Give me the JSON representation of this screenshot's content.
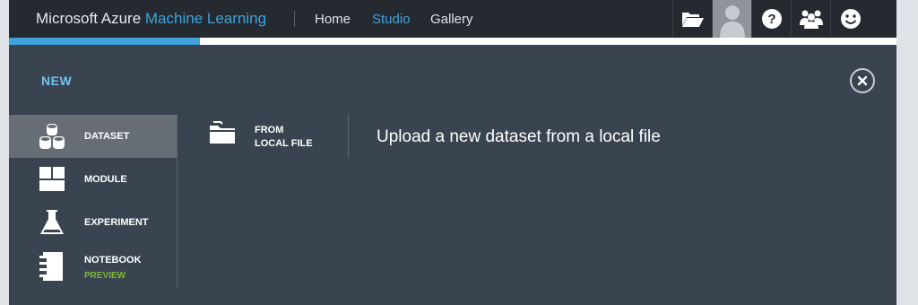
{
  "header": {
    "brand_prefix": "Microsoft Azure",
    "brand_accent": "Machine Learning",
    "nav": [
      {
        "label": "Home",
        "active": false
      },
      {
        "label": "Studio",
        "active": true
      },
      {
        "label": "Gallery",
        "active": false
      }
    ],
    "icons": [
      "folder-open-icon",
      "user-avatar-icon",
      "help-icon",
      "community-icon",
      "feedback-smiley-icon"
    ]
  },
  "progress": {
    "fraction": 0.215
  },
  "panel": {
    "title": "NEW",
    "close_icon": "close-icon"
  },
  "sidebar": {
    "items": [
      {
        "label": "DATASET",
        "icon": "dataset-cylinders-icon",
        "active": true
      },
      {
        "label": "MODULE",
        "icon": "module-blocks-icon",
        "active": false
      },
      {
        "label": "EXPERIMENT",
        "icon": "experiment-flask-icon",
        "active": false
      },
      {
        "label": "NOTEBOOK",
        "sublabel": "PREVIEW",
        "icon": "notebook-icon",
        "active": false
      }
    ]
  },
  "option": {
    "icon": "folder-icon",
    "label": "FROM\nLOCAL FILE",
    "description": "Upload a new dataset from a local file"
  },
  "colors": {
    "accent": "#3fa2da",
    "topbar": "#252a31",
    "panel": "#3a4450",
    "active_item": "#666d75",
    "preview": "#7cb83a"
  }
}
